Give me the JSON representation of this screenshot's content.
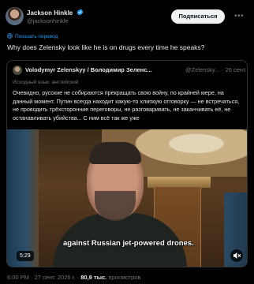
{
  "tweet": {
    "author": {
      "name": "Jackson Hinkle",
      "handle": "@jacksonhinkle",
      "verified_color": "#1d9bf0"
    },
    "subscribe_label": "Подписаться",
    "more_icon": "more-horizontal-icon",
    "translate_label": "Показать перевод",
    "text": "Why does Zelensky look like he is on drugs every time he speaks?",
    "meta": {
      "time": "6:00 PM",
      "separator": "·",
      "date": "27 сент. 2026 г.",
      "views": "80,9 тыс.",
      "views_label": "просмотров"
    }
  },
  "quote": {
    "author_name": "Volodymyr Zelenskyy / Володимир Зеленс...",
    "author_handle": "@Zelensky...",
    "date": "· 26 сент.",
    "lang_note": "Исходный язык: английский",
    "text": "Очевидно, русские не собираются прекращать свою войну, по крайней мере, на данный момент. Путин всегда находит какую-то хлипкую отговорку — не встречаться, не проводить трёхсторонние переговоры, не разговаривать, не заканчивать её, не останавливать убийства... С ним всё так же уже",
    "video": {
      "subtitle": "against Russian jet-powered drones.",
      "duration": "5:29",
      "mute_icon": "speaker-muted-icon"
    }
  }
}
